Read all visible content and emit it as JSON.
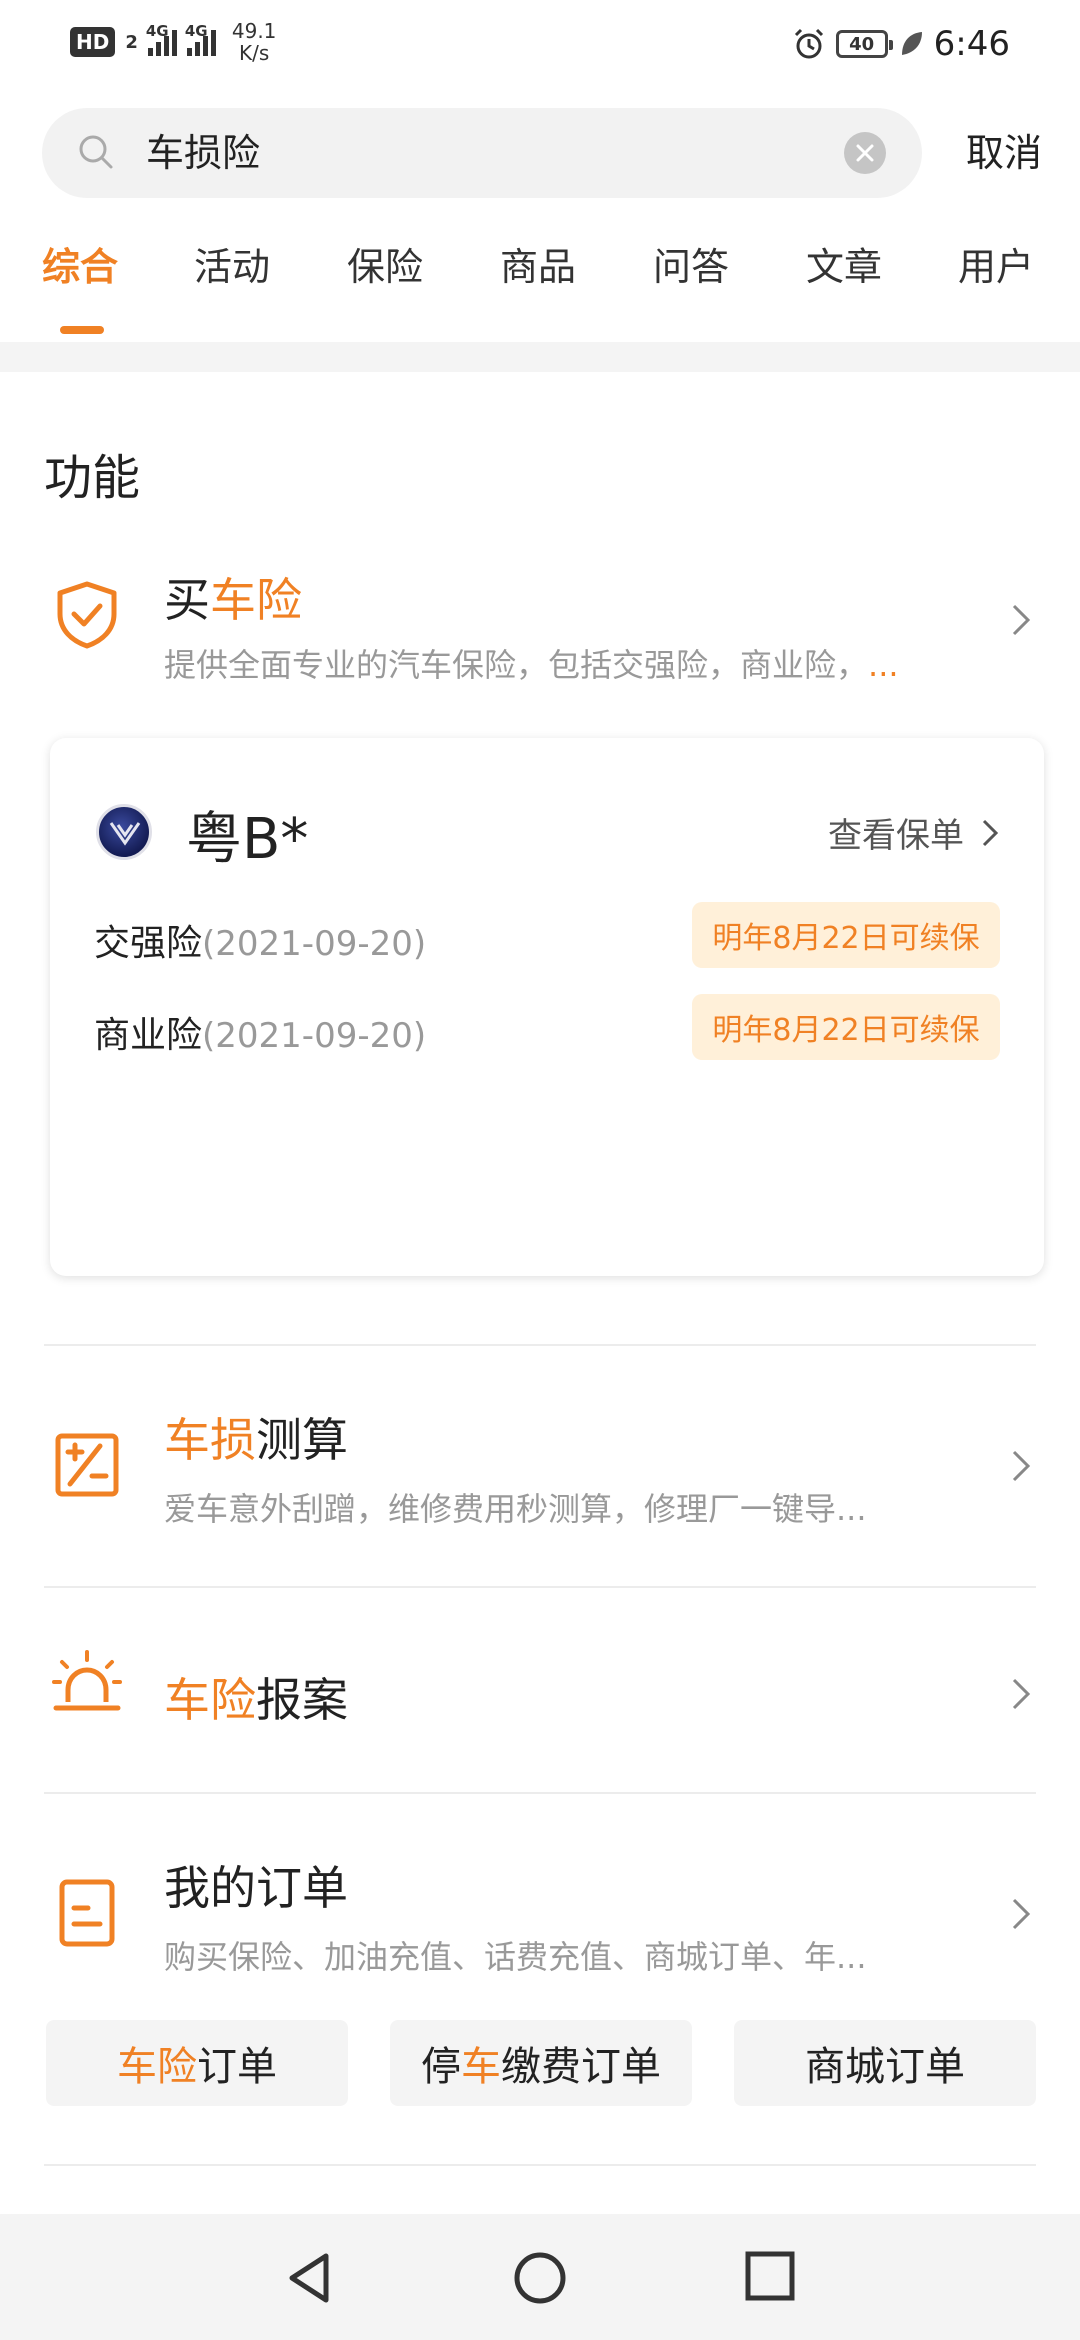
{
  "status_bar": {
    "hd": "HD",
    "sim": "2",
    "net1": "4G",
    "net2": "4G",
    "speed_value": "49.1",
    "speed_unit": "K/s",
    "battery": "40",
    "time": "6:46"
  },
  "search": {
    "query": "车损险",
    "cancel_label": "取消"
  },
  "tabs": [
    {
      "label": "综合",
      "active": true
    },
    {
      "label": "活动"
    },
    {
      "label": "保险"
    },
    {
      "label": "商品"
    },
    {
      "label": "问答"
    },
    {
      "label": "文章"
    },
    {
      "label": "用户"
    }
  ],
  "section": {
    "title": "功能"
  },
  "buy_insurance": {
    "title_prefix": "买",
    "title_highlight": "车险",
    "subtitle": "提供全面专业的汽车保险，包括交强险，商业险，",
    "subtitle_ellipsis": "..."
  },
  "policy_card": {
    "plate": "粤B*",
    "view_policy": "查看保单",
    "items": [
      {
        "name": "交强险",
        "date": "(2021-09-20)",
        "badge": "明年8月22日可续保"
      },
      {
        "name": "商业险",
        "date": "(2021-09-20)",
        "badge": "明年8月22日可续保"
      }
    ]
  },
  "damage_calc": {
    "title_highlight": "车损",
    "title_suffix": "测算",
    "subtitle": "爱车意外刮蹭，维修费用秒测算，修理厂一键导..."
  },
  "report_claim": {
    "title_highlight": "车险",
    "title_suffix": "报案"
  },
  "my_orders": {
    "title": "我的订单",
    "subtitle": "购买保险、加油充值、话费充值、商城订单、年...",
    "buttons": [
      {
        "prefix": "",
        "highlight": "车险",
        "suffix": "订单"
      },
      {
        "prefix": "停",
        "highlight": "车",
        "suffix": "缴费订单"
      },
      {
        "prefix": "",
        "highlight": "",
        "suffix": "商城订单"
      }
    ]
  },
  "colors": {
    "accent": "#f08124",
    "badge_bg": "#fff0d9"
  }
}
